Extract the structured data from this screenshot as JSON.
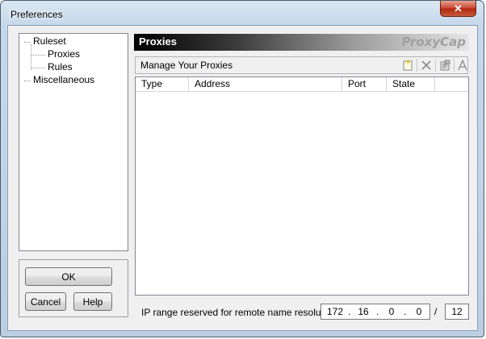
{
  "window": {
    "title": "Preferences",
    "close_glyph": "✕"
  },
  "tree": {
    "items": [
      {
        "label": "Ruleset"
      },
      {
        "label": "Proxies"
      },
      {
        "label": "Rules"
      },
      {
        "label": "Miscellaneous"
      }
    ]
  },
  "buttons": {
    "ok": "OK",
    "cancel": "Cancel",
    "help": "Help"
  },
  "panel": {
    "title": "Proxies",
    "brand": "ProxyCap",
    "manage_label": "Manage Your Proxies",
    "toolbar_icons": [
      "new-proxy-icon",
      "delete-icon",
      "properties-icon",
      "font-a-icon"
    ]
  },
  "list": {
    "columns": [
      "Type",
      "Address",
      "Port",
      "State"
    ],
    "rows": []
  },
  "ip_range": {
    "label": "IP range reserved for remote name resolution:",
    "octets": [
      "172",
      "16",
      "0",
      "0"
    ],
    "mask": "12"
  }
}
